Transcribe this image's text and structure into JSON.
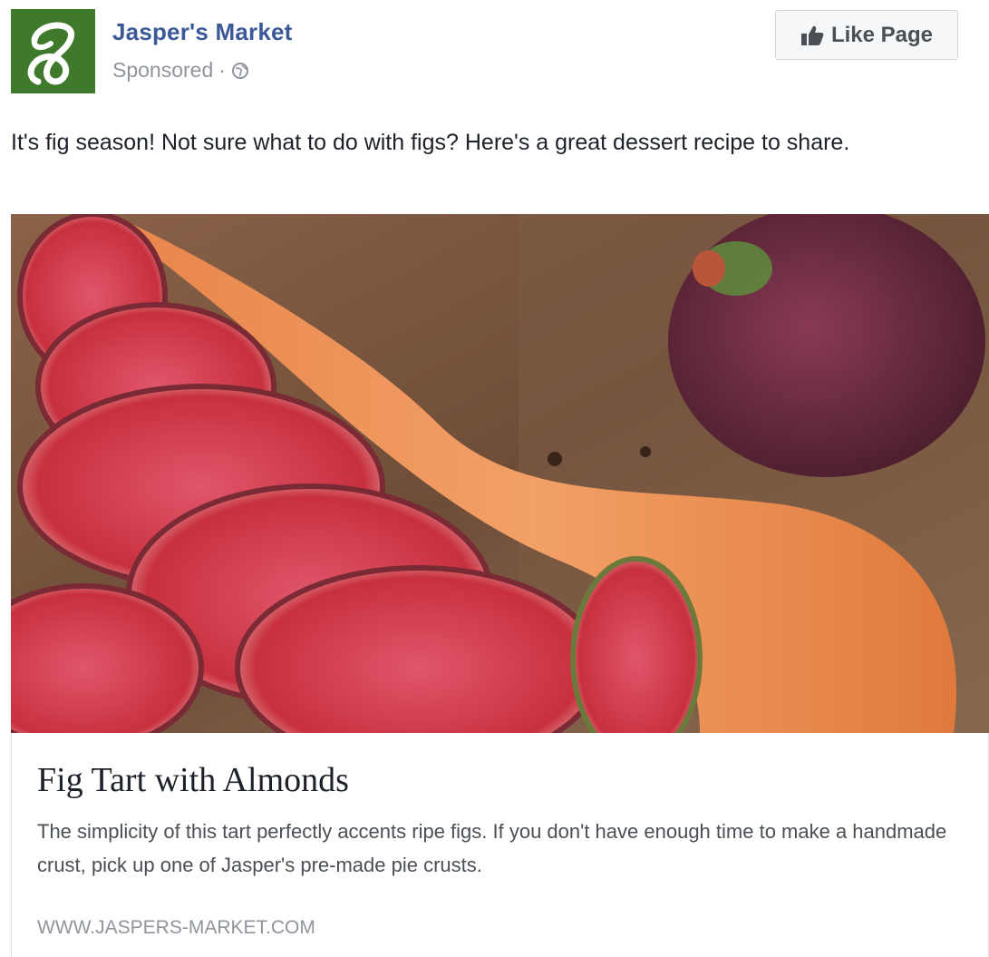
{
  "header": {
    "page_name": "Jasper's Market",
    "sponsored": "Sponsored",
    "separator": "·",
    "audience_icon": "globe-icon",
    "logo_icon": "script-j-logo",
    "like_button": {
      "icon": "thumbs-up-icon",
      "label": "Like Page"
    }
  },
  "post": {
    "text": "It's fig season! Not sure what to do with figs? Here's a great dessert recipe to share."
  },
  "link_card": {
    "image_subject": "fig-tart-photo",
    "title": "Fig Tart with Almonds",
    "description": "The simplicity of this tart perfectly accents ripe figs. If you don't have enough time to make a handmade crust, pick up one of Jasper's pre-made pie crusts.",
    "url": "WWW.JASPERS-MARKET.COM"
  },
  "colors": {
    "brand_green": "#3f7a2c",
    "link_blue": "#3b5998",
    "meta_gray": "#90949c"
  }
}
